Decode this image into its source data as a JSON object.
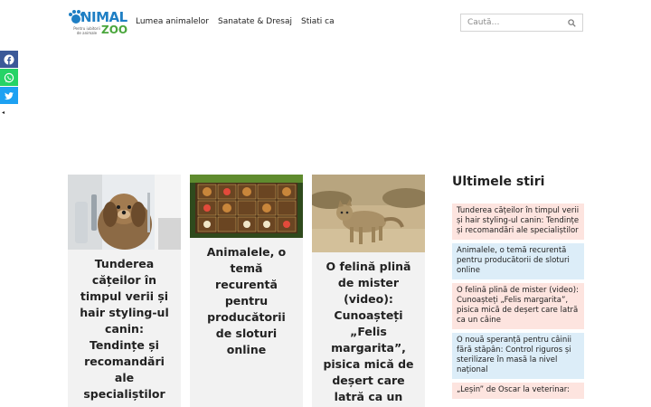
{
  "header": {
    "logo": {
      "word1": "NIMAL",
      "word2": "ZOO",
      "tagline": "Pentru iubitorii de animale",
      "brand_color": "#1f7fc4",
      "accent_color": "#4aa63c"
    },
    "nav": [
      "Lumea animalelor",
      "Sanatate & Dresaj",
      "Stiati ca"
    ],
    "search": {
      "placeholder": "Caută…",
      "icon": "search-icon"
    }
  },
  "share": {
    "icons": [
      "facebook-icon",
      "whatsapp-icon",
      "twitter-icon"
    ],
    "colors": [
      "#3b5998",
      "#25d366",
      "#1da1f2"
    ]
  },
  "cards": [
    {
      "title": "Tunderea cățeilor în timpul verii și hair styling-ul canin: Tendințe și recomandări ale specialiștilor"
    },
    {
      "title": "Animalele, o temă recurentă pentru producătorii de sloturi online"
    },
    {
      "title": "O felină plină de mister (video): Cunoașteți „Felis margarita”, pisica mică de deșert care latră ca un câine"
    }
  ],
  "sidebar": {
    "title": "Ultimele stiri",
    "items": [
      {
        "text": "Tunderea cățeilor în timpul verii și hair styling-ul canin: Tendințe și recomandări ale specialiștilor",
        "color": "pink"
      },
      {
        "text": "Animalele, o temă recurentă pentru producătorii de sloturi online",
        "color": "blue"
      },
      {
        "text": "O felină plină de mister (video): Cunoașteți „Felis margarita”, pisica mică de deșert care latră ca un câine",
        "color": "pink"
      },
      {
        "text": "O nouă speranță pentru câinii fără stăpân: Control riguros și sterilizare în masă la nivel național",
        "color": "blue"
      },
      {
        "text": "„Leșin” de Oscar la veterinar:",
        "color": "pink"
      }
    ]
  }
}
